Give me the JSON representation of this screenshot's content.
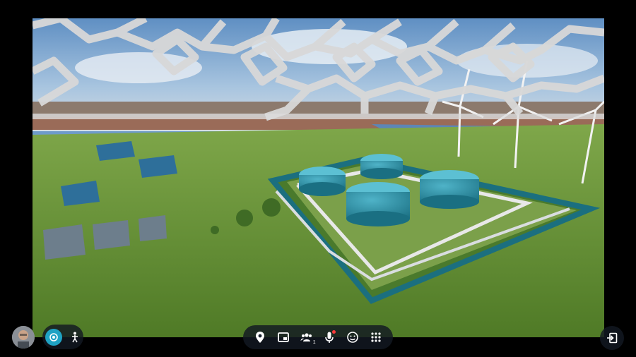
{
  "scene": {
    "description_free": true,
    "colors": {
      "sky": "#7aa6d4",
      "grass": "#6f9a3c",
      "tank": "#2b8fa3",
      "teal_edge": "#1b6f7f",
      "dome": "#d8d8d8"
    }
  },
  "left_controls": {
    "presence_icon": "radar-icon",
    "walk_icon": "walking-person-icon",
    "accent": "#1fa3c4"
  },
  "avatar": {
    "icon": "user-avatar"
  },
  "toolbar": {
    "items": [
      {
        "icon": "map-pin-icon"
      },
      {
        "icon": "window-icon"
      },
      {
        "icon": "people-icon",
        "count": "1"
      },
      {
        "icon": "microphone-icon",
        "status_color": "#ff3b3b"
      },
      {
        "icon": "smiley-icon"
      },
      {
        "icon": "grid-icon"
      }
    ]
  },
  "exit": {
    "icon": "exit-icon"
  }
}
